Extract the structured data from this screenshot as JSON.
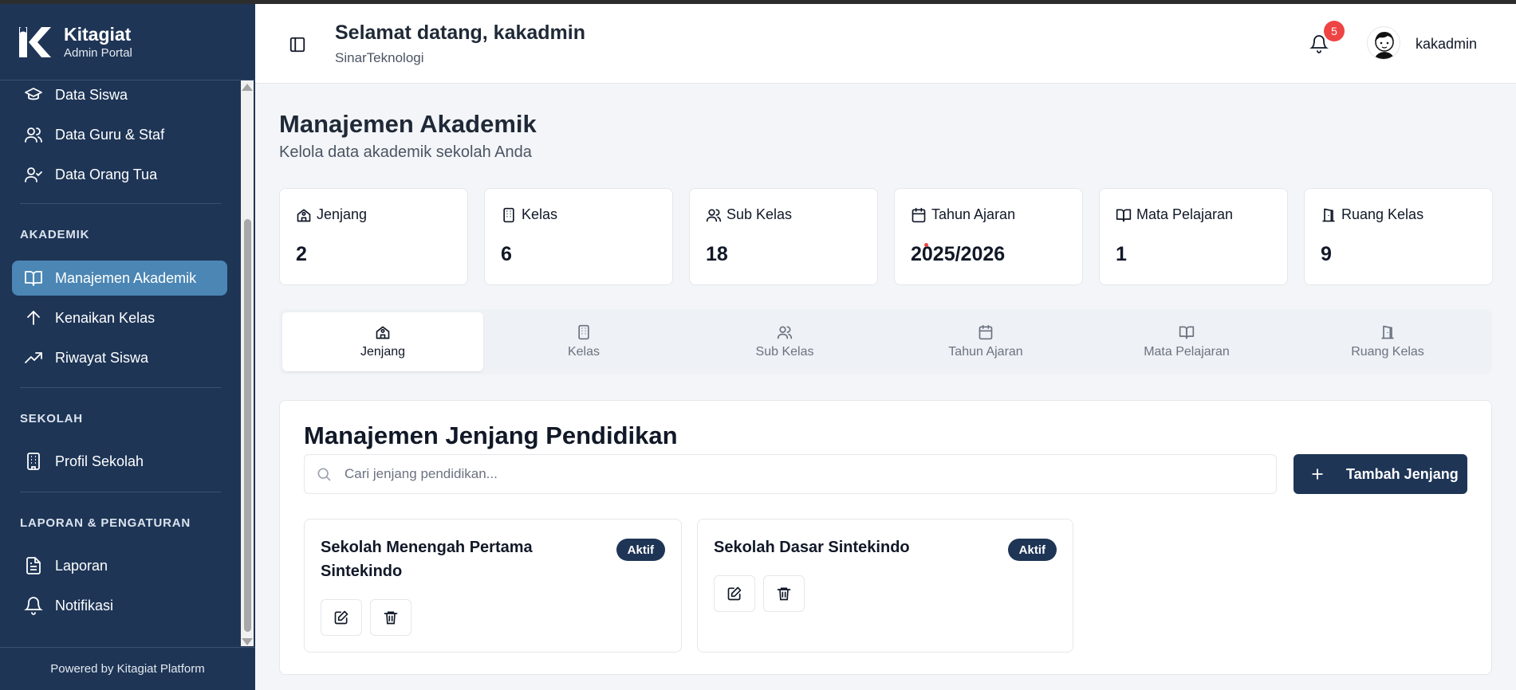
{
  "brand": {
    "title": "Kitagiat",
    "subtitle": "Admin Portal"
  },
  "sidebar": {
    "items": [
      {
        "label": "Data Siswa",
        "icon": "graduation-cap-icon"
      },
      {
        "label": "Data Guru & Staf",
        "icon": "users-icon"
      },
      {
        "label": "Data Orang Tua",
        "icon": "user-check-icon"
      },
      {
        "label": "Manajemen Akademik",
        "icon": "book-open-icon",
        "active": true
      },
      {
        "label": "Kenaikan Kelas",
        "icon": "arrow-up-icon"
      },
      {
        "label": "Riwayat Siswa",
        "icon": "trending-up-icon"
      },
      {
        "label": "Profil Sekolah",
        "icon": "building-icon"
      },
      {
        "label": "Laporan",
        "icon": "file-text-icon"
      },
      {
        "label": "Notifikasi",
        "icon": "bell-icon"
      }
    ],
    "sections": {
      "akademik": "AKADEMIK",
      "sekolah": "SEKOLAH",
      "laporan": "LAPORAN & PENGATURAN"
    },
    "footer": "Powered by Kitagiat Platform"
  },
  "header": {
    "welcome": "Selamat datang, kakadmin",
    "org": "SinarTeknologi",
    "notification_count": "5",
    "username": "kakadmin"
  },
  "page": {
    "title": "Manajemen Akademik",
    "subtitle": "Kelola data akademik sekolah Anda"
  },
  "stats": [
    {
      "label": "Jenjang",
      "value": "2",
      "icon": "school-icon"
    },
    {
      "label": "Kelas",
      "value": "6",
      "icon": "building-icon"
    },
    {
      "label": "Sub Kelas",
      "value": "18",
      "icon": "users-icon"
    },
    {
      "label": "Tahun Ajaran",
      "value": "2025/2026",
      "icon": "calendar-icon"
    },
    {
      "label": "Mata Pelajaran",
      "value": "1",
      "icon": "book-open-icon"
    },
    {
      "label": "Ruang Kelas",
      "value": "9",
      "icon": "door-icon"
    }
  ],
  "tabs": [
    {
      "label": "Jenjang",
      "icon": "school-icon",
      "active": true
    },
    {
      "label": "Kelas",
      "icon": "building-icon"
    },
    {
      "label": "Sub Kelas",
      "icon": "users-icon"
    },
    {
      "label": "Tahun Ajaran",
      "icon": "calendar-icon"
    },
    {
      "label": "Mata Pelajaran",
      "icon": "book-open-icon"
    },
    {
      "label": "Ruang Kelas",
      "icon": "door-icon"
    }
  ],
  "panel": {
    "title": "Manajemen Jenjang Pendidikan",
    "search_placeholder": "Cari jenjang pendidikan...",
    "add_label": "Tambah Jenjang",
    "cards": [
      {
        "name": "Sekolah Menengah Pertama Sintekindo",
        "status": "Aktif"
      },
      {
        "name": "Sekolah Dasar Sintekindo",
        "status": "Aktif"
      }
    ]
  },
  "colors": {
    "sidebar": "#1e3556",
    "active_nav": "#4b86b4",
    "badge": "#ef4444",
    "primary": "#1e3556"
  }
}
